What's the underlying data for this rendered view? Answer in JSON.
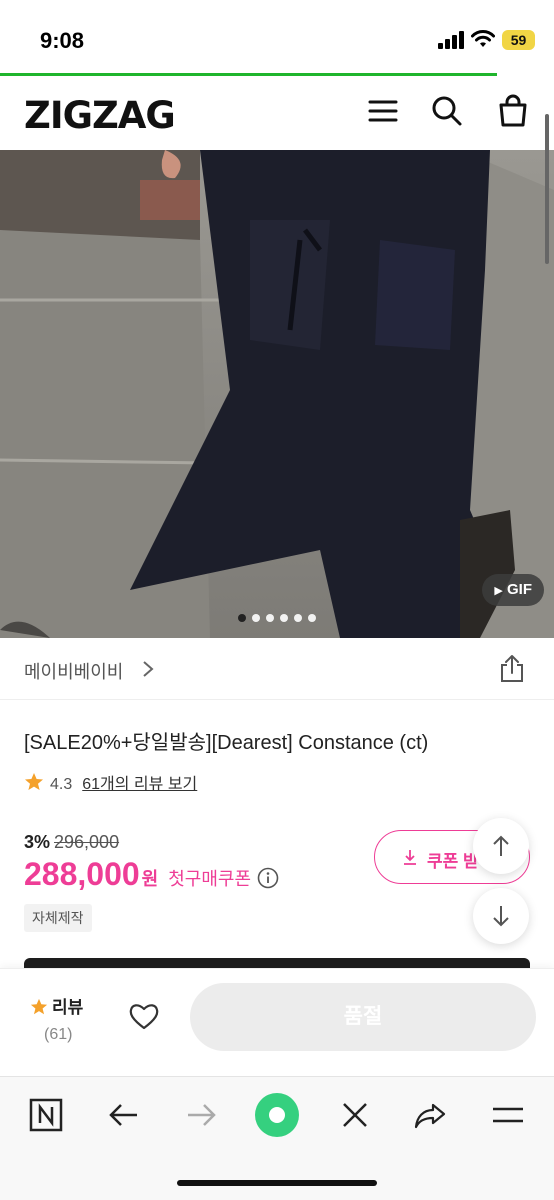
{
  "status_bar": {
    "time": "9:08",
    "battery": "59"
  },
  "header": {
    "logo": "ZIGZAG"
  },
  "gallery": {
    "badge": "GIF",
    "slide_count": 6,
    "active_slide": 1
  },
  "product": {
    "brand": "메이비베이비",
    "title": "[SALE20%+당일발송][Dearest] Constance (ct)",
    "rating": "4.3",
    "review_link": "61개의 리뷰 보기",
    "discount_pct": "3%",
    "original_price": "296,000",
    "price": "288,000",
    "currency": "원",
    "coupon_note": "첫구매쿠폰",
    "coupon_button": "쿠폰 받",
    "tag": "자체제작"
  },
  "buy_bar": {
    "review_label": "리뷰",
    "review_count": "(61)",
    "soldout_label": "품절"
  },
  "colors": {
    "accent": "#ee3d96",
    "star": "#f4a12b",
    "loading": "#1fb52c",
    "browser_center": "#35d07f"
  }
}
